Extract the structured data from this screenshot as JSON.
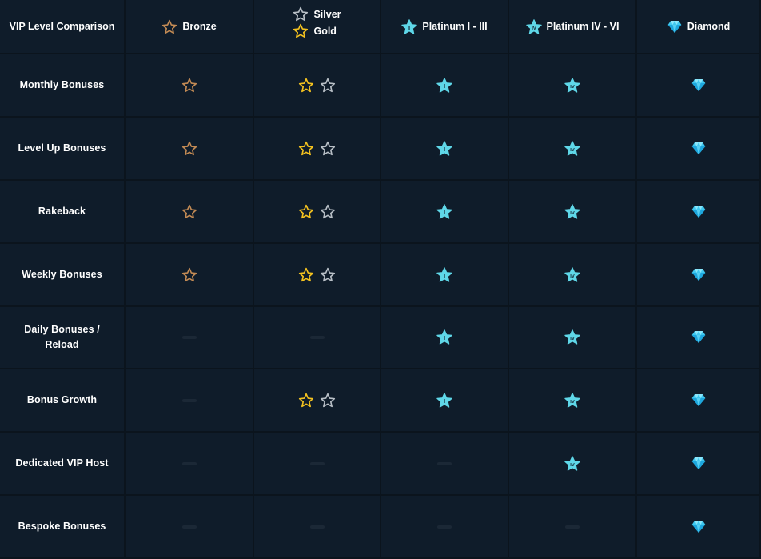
{
  "colors": {
    "background": "#0f1c2a",
    "bronze": "#c28a54",
    "silver": "#b8bfc6",
    "gold": "#f4c21f",
    "platinum": "#5fd7e8",
    "diamond": "#3fc8f0",
    "dash": "#1b2836"
  },
  "header": {
    "title": "VIP Level Comparison",
    "columns": [
      {
        "labels": [
          "Bronze"
        ],
        "icons": [
          "bronze-star-icon"
        ]
      },
      {
        "labels": [
          "Silver",
          "Gold"
        ],
        "icons": [
          "silver-star-icon",
          "gold-star-icon"
        ]
      },
      {
        "labels": [
          "Platinum I - III"
        ],
        "icons": [
          "platinum-i-badge-icon"
        ]
      },
      {
        "labels": [
          "Platinum IV - VI"
        ],
        "icons": [
          "platinum-iv-badge-icon"
        ]
      },
      {
        "labels": [
          "Diamond"
        ],
        "icons": [
          "diamond-icon"
        ]
      }
    ]
  },
  "rows": [
    {
      "label": [
        "Monthly Bonuses"
      ],
      "cells": [
        "bronze",
        "silvergold",
        "plat1",
        "plat4",
        "diamond"
      ]
    },
    {
      "label": [
        "Level Up Bonuses"
      ],
      "cells": [
        "bronze",
        "silvergold",
        "plat1",
        "plat4",
        "diamond"
      ]
    },
    {
      "label": [
        "Rakeback"
      ],
      "cells": [
        "bronze",
        "silvergold",
        "plat1",
        "plat4",
        "diamond"
      ]
    },
    {
      "label": [
        "Weekly Bonuses"
      ],
      "cells": [
        "bronze",
        "silvergold",
        "plat1",
        "plat4",
        "diamond"
      ]
    },
    {
      "label": [
        "Daily Bonuses /",
        "Reload"
      ],
      "cells": [
        "none",
        "none",
        "plat1",
        "plat4",
        "diamond"
      ]
    },
    {
      "label": [
        "Bonus Growth"
      ],
      "cells": [
        "none",
        "silvergold",
        "plat1",
        "plat4",
        "diamond"
      ]
    },
    {
      "label": [
        "Dedicated VIP Host"
      ],
      "cells": [
        "none",
        "none",
        "none",
        "plat4",
        "diamond"
      ]
    },
    {
      "label": [
        "Bespoke Bonuses"
      ],
      "cells": [
        "none",
        "none",
        "none",
        "none",
        "diamond"
      ]
    }
  ]
}
